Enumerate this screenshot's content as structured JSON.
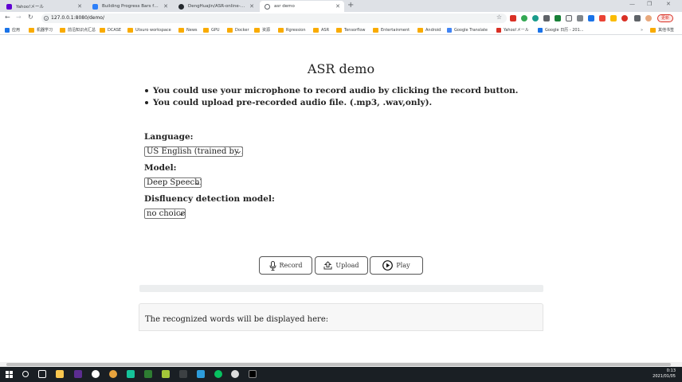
{
  "browser": {
    "tabs": [
      {
        "title": "Yahoo!メール",
        "active": false
      },
      {
        "title": "Building Progress Bars for the",
        "active": false
      },
      {
        "title": "DengHuajin/ASR-online-demo",
        "active": false
      },
      {
        "title": "asr demo",
        "active": true
      }
    ],
    "url": "127.0.0.1:8080/demo/",
    "update_label": "更新",
    "bookmarks": [
      {
        "label": "应用",
        "type": "apps"
      },
      {
        "label": "机器学习",
        "type": "folder"
      },
      {
        "label": "前沿知识点汇总",
        "type": "folder"
      },
      {
        "label": "DCASE",
        "type": "folder"
      },
      {
        "label": "Utsuro workspace",
        "type": "folder"
      },
      {
        "label": "News",
        "type": "folder"
      },
      {
        "label": "GPU",
        "type": "folder"
      },
      {
        "label": "Docker",
        "type": "folder"
      },
      {
        "label": "资源",
        "type": "folder"
      },
      {
        "label": "Rgression",
        "type": "folder"
      },
      {
        "label": "ASR",
        "type": "folder"
      },
      {
        "label": "Tensorflow",
        "type": "folder"
      },
      {
        "label": "Entertainment",
        "type": "folder"
      },
      {
        "label": "Android",
        "type": "folder"
      },
      {
        "label": "Google Translate",
        "type": "site"
      },
      {
        "label": "Yahoo!メール",
        "type": "site"
      },
      {
        "label": "Google 日历 - 201...",
        "type": "site"
      }
    ],
    "other_bookmarks": "其他书签"
  },
  "page": {
    "title": "ASR demo",
    "instructions": [
      "You could use your microphone to record audio by clicking the record button.",
      "You could upload pre-recorded audio file. (.mp3, .wav,only)."
    ],
    "language_label": "Language:",
    "language_value": "US English (trained by LibriSpeech)",
    "model_label": "Model:",
    "model_value": "Deep Speech2",
    "disfluency_label": "Disfluency detection model:",
    "disfluency_value": "no choice",
    "buttons": {
      "record": "Record",
      "upload": "Upload",
      "play": "Play"
    },
    "result_placeholder": "The recognized words will be displayed here:"
  },
  "taskbar": {
    "time": "0:13",
    "date": "2021/01/05"
  },
  "colors": {
    "tabstrip": "#dee1e6",
    "progress_bg": "#eceeef",
    "result_bg": "#f7f7f7",
    "taskbar": "#1a1f24"
  }
}
